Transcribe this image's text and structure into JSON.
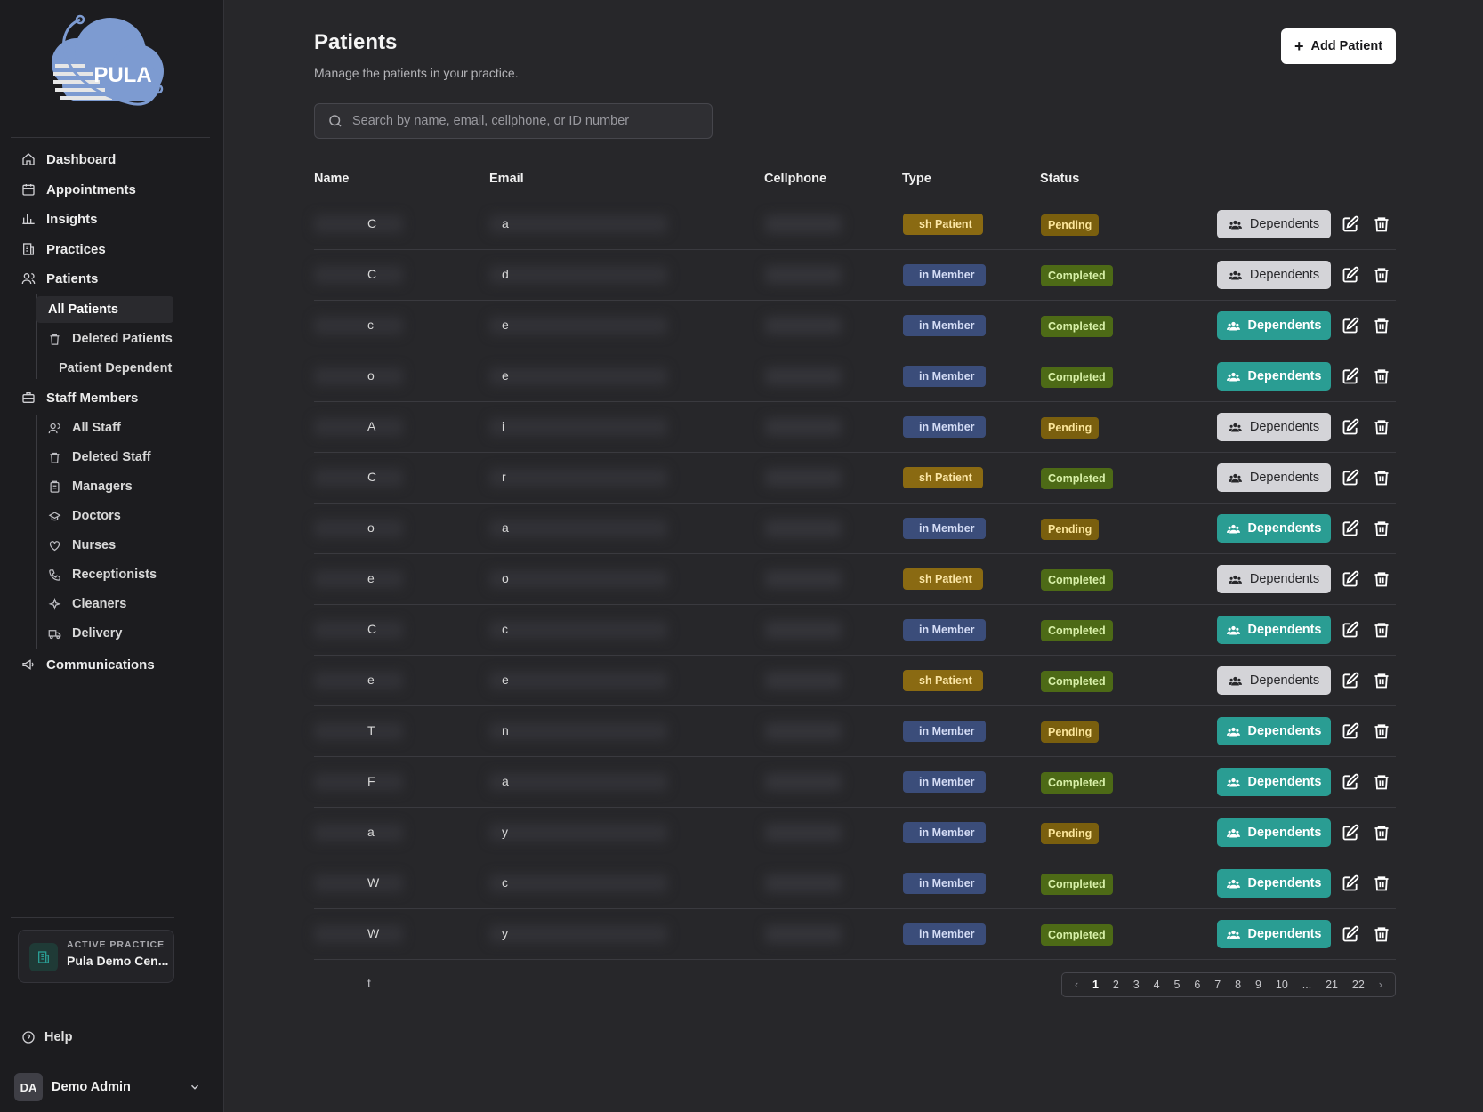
{
  "brand": {
    "logo_text": "PULA"
  },
  "sidebar": {
    "nav": [
      {
        "label": "Dashboard",
        "icon": "home-icon"
      },
      {
        "label": "Appointments",
        "icon": "calendar-icon"
      },
      {
        "label": "Insights",
        "icon": "bar-chart-icon"
      },
      {
        "label": "Practices",
        "icon": "building-icon"
      },
      {
        "label": "Patients",
        "icon": "users-icon"
      }
    ],
    "patients_sub": [
      {
        "label": "All Patients",
        "icon": ""
      },
      {
        "label": "Deleted Patients",
        "icon": "trash-icon"
      },
      {
        "label": "Patient Dependents",
        "icon": "users-group-icon"
      }
    ],
    "staff": {
      "label": "Staff Members",
      "icon": "briefcase-icon"
    },
    "staff_sub": [
      {
        "label": "All Staff",
        "icon": "users-icon"
      },
      {
        "label": "Deleted Staff",
        "icon": "trash-icon"
      },
      {
        "label": "Managers",
        "icon": "clipboard-icon"
      },
      {
        "label": "Doctors",
        "icon": "stethoscope-icon"
      },
      {
        "label": "Nurses",
        "icon": "heart-icon"
      },
      {
        "label": "Receptionists",
        "icon": "phone-icon"
      },
      {
        "label": "Cleaners",
        "icon": "sparkles-icon"
      },
      {
        "label": "Delivery",
        "icon": "truck-icon"
      }
    ],
    "communications": {
      "label": "Communications",
      "icon": "megaphone-icon"
    },
    "active_practice": {
      "kicker": "ACTIVE PRACTICE",
      "name": "Pula Demo Cen..."
    },
    "help": "Help",
    "user": {
      "initials": "DA",
      "name": "Demo Admin"
    }
  },
  "page": {
    "title": "Patients",
    "subtitle": "Manage the patients in your practice.",
    "add_button": "Add Patient",
    "search_placeholder": "Search by name, email, cellphone, or ID number"
  },
  "table": {
    "headers": [
      "Name",
      "Email",
      "Cellphone",
      "Type",
      "Status"
    ],
    "dependents_label": "Dependents",
    "rows": [
      {
        "name_frag": "C",
        "email_frag": "a",
        "type": "sh Patient",
        "type_kind": "cash",
        "status": "Pending",
        "dep_style": "light"
      },
      {
        "name_frag": "C",
        "email_frag": "d",
        "type": "in Member",
        "type_kind": "med",
        "status": "Completed",
        "dep_style": "light"
      },
      {
        "name_frag": "c",
        "email_frag": "e",
        "type": "in Member",
        "type_kind": "med",
        "status": "Completed",
        "dep_style": "teal"
      },
      {
        "name_frag": "o",
        "email_frag": "e",
        "type": "in Member",
        "type_kind": "med",
        "status": "Completed",
        "dep_style": "teal"
      },
      {
        "name_frag": "A",
        "email_frag": "i",
        "type": "in Member",
        "type_kind": "med",
        "status": "Pending",
        "dep_style": "light"
      },
      {
        "name_frag": "C",
        "email_frag": "r",
        "type": "sh Patient",
        "type_kind": "cash",
        "status": "Completed",
        "dep_style": "light"
      },
      {
        "name_frag": "o",
        "email_frag": "a",
        "type": "in Member",
        "type_kind": "med",
        "status": "Pending",
        "dep_style": "teal"
      },
      {
        "name_frag": "e",
        "email_frag": "o",
        "type": "sh Patient",
        "type_kind": "cash",
        "status": "Completed",
        "dep_style": "light"
      },
      {
        "name_frag": "C",
        "email_frag": "c",
        "type": "in Member",
        "type_kind": "med",
        "status": "Completed",
        "dep_style": "teal"
      },
      {
        "name_frag": "e",
        "email_frag": "e",
        "type": "sh Patient",
        "type_kind": "cash",
        "status": "Completed",
        "dep_style": "light"
      },
      {
        "name_frag": "T",
        "email_frag": "n",
        "type": "in Member",
        "type_kind": "med",
        "status": "Pending",
        "dep_style": "teal"
      },
      {
        "name_frag": "F",
        "email_frag": "a",
        "type": "in Member",
        "type_kind": "med",
        "status": "Completed",
        "dep_style": "teal"
      },
      {
        "name_frag": "a",
        "email_frag": "y",
        "type": "in Member",
        "type_kind": "med",
        "status": "Pending",
        "dep_style": "teal"
      },
      {
        "name_frag": "W",
        "email_frag": "c",
        "type": "in Member",
        "type_kind": "med",
        "status": "Completed",
        "dep_style": "teal"
      },
      {
        "name_frag": "W",
        "email_frag": "y",
        "type": "in Member",
        "type_kind": "med",
        "status": "Completed",
        "dep_style": "teal"
      }
    ]
  },
  "footer_frag": "t",
  "pagination": {
    "pages": [
      "1",
      "2",
      "3",
      "4",
      "5",
      "6",
      "7",
      "8",
      "9",
      "10",
      "...",
      "21",
      "22"
    ],
    "current": "1"
  },
  "colors": {
    "accent_teal": "#2a9d93",
    "cash_badge": "#8a6a12",
    "member_badge": "#3b4d7a",
    "pending": "#7a5f0e",
    "completed": "#4d6a16"
  }
}
